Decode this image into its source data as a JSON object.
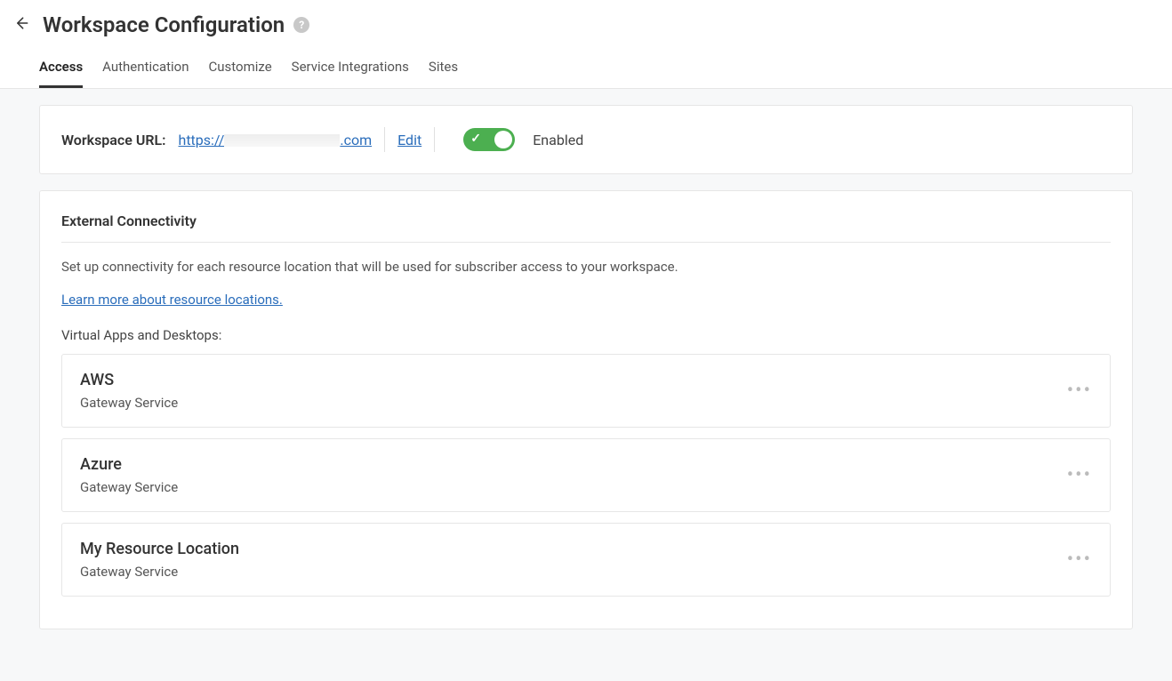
{
  "header": {
    "title": "Workspace Configuration"
  },
  "tabs": [
    {
      "label": "Access",
      "active": true
    },
    {
      "label": "Authentication",
      "active": false
    },
    {
      "label": "Customize",
      "active": false
    },
    {
      "label": "Service Integrations",
      "active": false
    },
    {
      "label": "Sites",
      "active": false
    }
  ],
  "url_card": {
    "label": "Workspace URL:",
    "url_prefix": "https://",
    "url_suffix": ".com",
    "edit_label": "Edit",
    "toggle_enabled": true,
    "toggle_label": "Enabled"
  },
  "connectivity": {
    "section_title": "External Connectivity",
    "description": "Set up connectivity for each resource location that will be used for subscriber access to your workspace.",
    "learn_more": "Learn more about resource locations.",
    "sub_label": "Virtual Apps and Desktops:",
    "resources": [
      {
        "name": "AWS",
        "service": "Gateway Service"
      },
      {
        "name": "Azure",
        "service": "Gateway Service"
      },
      {
        "name": "My Resource Location",
        "service": "Gateway Service"
      }
    ]
  }
}
